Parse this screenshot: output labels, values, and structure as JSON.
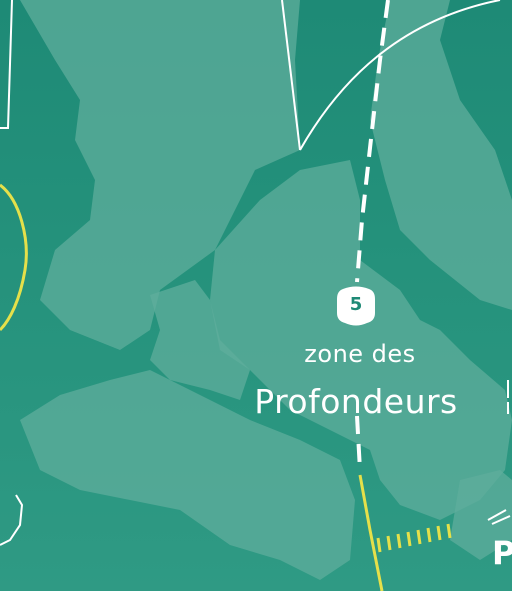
{
  "zone": {
    "subtitle": "zone des",
    "name": "Profondeurs"
  },
  "marker": {
    "number": "5"
  },
  "edge": {
    "partial_label": "P"
  },
  "colors": {
    "water": "#1e8a76",
    "shallows": "#5fae9c",
    "route_yellow": "#e5e04a",
    "line_white": "#ffffff"
  },
  "icons": {
    "marker": "hexagon-marker-icon"
  }
}
